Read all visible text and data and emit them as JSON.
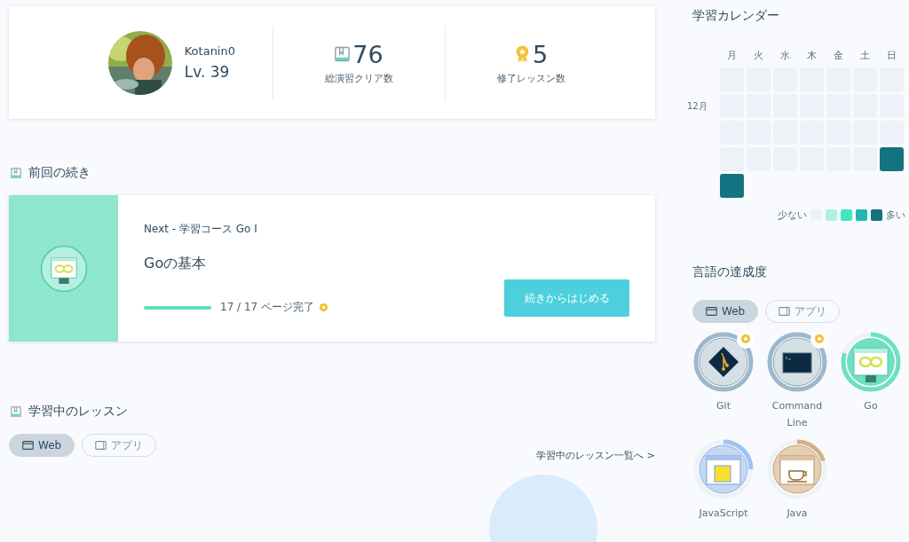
{
  "profile": {
    "username": "Kotanin0",
    "level_text": "Lv. 39",
    "stats": [
      {
        "kind": "book",
        "value": "76",
        "label": "総演習クリア数"
      },
      {
        "kind": "medal",
        "value": "5",
        "label": "修了レッスン数"
      }
    ]
  },
  "resume": {
    "heading": "前回の続き",
    "course": "Next - 学習コース Go Ⅰ",
    "lesson": "Goの基本",
    "progress": {
      "level": 1,
      "text": "17 / 17 ページ完了",
      "completed": true
    },
    "button": "続きからはじめる"
  },
  "learning": {
    "heading": "学習中のレッスン",
    "tabs": [
      {
        "label": "Web",
        "kind": "web",
        "selected": true
      },
      {
        "label": "アプリ",
        "kind": "app",
        "selected": false
      }
    ],
    "link": "学習中のレッスン一覧へ >"
  },
  "calendar": {
    "title": "学習カレンダー",
    "weekdays": [
      "月",
      "火",
      "水",
      "木",
      "金",
      "土",
      "日"
    ],
    "month": "12月",
    "cells": [
      {
        "color": "#edf1f8"
      },
      {
        "color": "#edf1f8"
      },
      {
        "color": "#edf1f8"
      },
      {
        "color": "#edf1f8"
      },
      {
        "color": "#edf1f8"
      },
      {
        "color": "#edf1f8"
      },
      {
        "color": "#edf1f8"
      },
      {
        "color": "#edf1f8"
      },
      {
        "color": "#edf1f8"
      },
      {
        "color": "#edf1f8"
      },
      {
        "color": "#edf1f8"
      },
      {
        "color": "#edf1f8"
      },
      {
        "color": "#edf1f8"
      },
      {
        "color": "#edf1f8"
      },
      {
        "color": "#edf1f8"
      },
      {
        "color": "#edf1f8"
      },
      {
        "color": "#edf1f8"
      },
      {
        "color": "#edf1f8"
      },
      {
        "color": "#edf1f8"
      },
      {
        "color": "#edf1f8"
      },
      {
        "color": "#edf1f8"
      },
      {
        "color": "#edf1f8"
      },
      {
        "color": "#edf1f8"
      },
      {
        "color": "#edf1f8"
      },
      {
        "color": "#edf1f8"
      },
      {
        "color": "#edf1f8"
      },
      {
        "color": "#edf1f8"
      },
      {
        "color": "#147380"
      },
      {
        "color": "#147380"
      }
    ],
    "legend_less": "少ない",
    "legend_more": "多い",
    "legend": [
      {
        "color": "#edf1f8"
      },
      {
        "color": "#b0f0e0"
      },
      {
        "color": "#40e8c0"
      },
      {
        "color": "#20b8b0"
      },
      {
        "color": "#147380"
      }
    ]
  },
  "languages": {
    "title": "言語の達成度",
    "tabs": [
      {
        "label": "Web",
        "kind": "web",
        "selected": true
      },
      {
        "label": "アプリ",
        "kind": "app",
        "selected": false
      }
    ],
    "items": [
      {
        "name": "Git",
        "kind": "git",
        "level": 1,
        "completed": true,
        "color": "#9db8cc"
      },
      {
        "name": "Command Line",
        "kind": "terminal",
        "level": 1,
        "completed": true,
        "color": "#9db8cc"
      },
      {
        "name": "Go",
        "kind": "go",
        "level": 0.8,
        "completed": false,
        "color": "#6ee0c0"
      },
      {
        "name": "JavaScript",
        "kind": "js",
        "level": 0.25,
        "completed": false,
        "color": "#9cc4f0"
      },
      {
        "name": "Java",
        "kind": "java",
        "level": 0.2,
        "completed": false,
        "color": "#d4b088"
      }
    ]
  }
}
